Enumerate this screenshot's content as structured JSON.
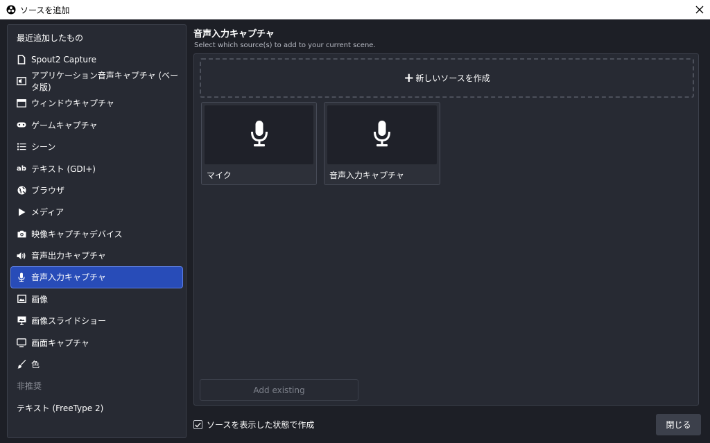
{
  "window": {
    "title": "ソースを追加",
    "close_icon": "close-icon"
  },
  "sources": {
    "header": "最近追加したもの",
    "items": [
      {
        "label": "Spout2 Capture",
        "icon": "file-icon"
      },
      {
        "label": "アプリケーション音声キャプチャ (ベータ版)",
        "icon": "app-audio-icon"
      },
      {
        "label": "ウィンドウキャプチャ",
        "icon": "window-icon"
      },
      {
        "label": "ゲームキャプチャ",
        "icon": "gamepad-icon"
      },
      {
        "label": "シーン",
        "icon": "list-icon"
      },
      {
        "label": "テキスト (GDI+)",
        "icon": "text-icon",
        "glyph": "ab"
      },
      {
        "label": "ブラウザ",
        "icon": "globe-icon"
      },
      {
        "label": "メディア",
        "icon": "play-icon"
      },
      {
        "label": "映像キャプチャデバイス",
        "icon": "camera-icon"
      },
      {
        "label": "音声出力キャプチャ",
        "icon": "speaker-icon"
      },
      {
        "label": "音声入力キャプチャ",
        "icon": "microphone-icon",
        "selected": true
      },
      {
        "label": "画像",
        "icon": "image-icon"
      },
      {
        "label": "画像スライドショー",
        "icon": "slideshow-icon"
      },
      {
        "label": "画面キャプチャ",
        "icon": "monitor-icon"
      },
      {
        "label": "色",
        "icon": "brush-icon"
      }
    ],
    "deprecated_header": "非推奨",
    "deprecated_items": [
      {
        "label": "テキスト (FreeType 2)"
      }
    ]
  },
  "panel": {
    "title": "音声入力キャプチャ",
    "subtitle": "Select which source(s) to add to your current scene.",
    "new_source_label": "新しいソースを作成",
    "existing": [
      {
        "label": "マイク",
        "icon": "microphone-icon"
      },
      {
        "label": "音声入力キャプチャ",
        "icon": "microphone-icon"
      }
    ],
    "add_existing_label": "Add existing"
  },
  "footer": {
    "visible_label": "ソースを表示した状態で作成",
    "visible_checked": true,
    "close_label": "閉じる"
  },
  "colors": {
    "background": "#1d1f26",
    "panel": "#272a33",
    "selected": "#284cb8",
    "selected_border": "#5d7fe3"
  }
}
